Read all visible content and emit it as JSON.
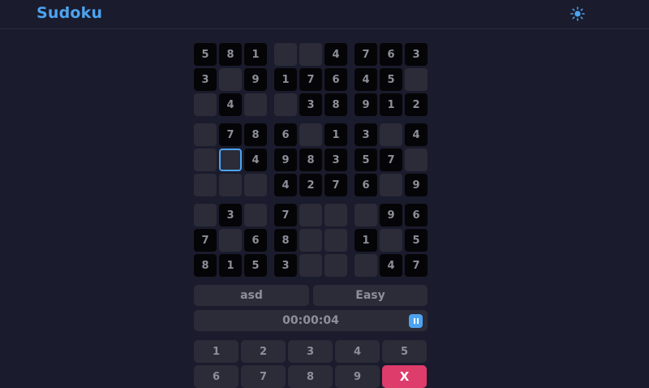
{
  "app": {
    "title": "Sudoku"
  },
  "colors": {
    "accent": "#4da3f0",
    "erase": "#de3c6b"
  },
  "icons": {
    "theme_toggle": "sun-icon",
    "pause": "pause-icon"
  },
  "board": {
    "selected": [
      4,
      1
    ],
    "rows": [
      [
        "5",
        "8",
        "1",
        "",
        "",
        "4",
        "7",
        "6",
        "3"
      ],
      [
        "3",
        "",
        "9",
        "1",
        "7",
        "6",
        "4",
        "5",
        ""
      ],
      [
        "",
        "4",
        "",
        "",
        "3",
        "8",
        "9",
        "1",
        "2"
      ],
      [
        "",
        "7",
        "8",
        "6",
        "",
        "1",
        "3",
        "",
        "4"
      ],
      [
        "",
        "",
        "4",
        "9",
        "8",
        "3",
        "5",
        "7",
        ""
      ],
      [
        "",
        "",
        "",
        "4",
        "2",
        "7",
        "6",
        "",
        "9"
      ],
      [
        "",
        "3",
        "",
        "7",
        "",
        "",
        "",
        "9",
        "6"
      ],
      [
        "7",
        "",
        "6",
        "8",
        "",
        "",
        "1",
        "",
        "5"
      ],
      [
        "8",
        "1",
        "5",
        "3",
        "",
        "",
        "",
        "4",
        "7"
      ]
    ]
  },
  "game": {
    "name": "asd",
    "difficulty": "Easy",
    "timer": "00:00:04"
  },
  "keypad": {
    "row1": [
      "1",
      "2",
      "3",
      "4",
      "5"
    ],
    "row2": [
      "6",
      "7",
      "8",
      "9"
    ],
    "erase_label": "X"
  }
}
